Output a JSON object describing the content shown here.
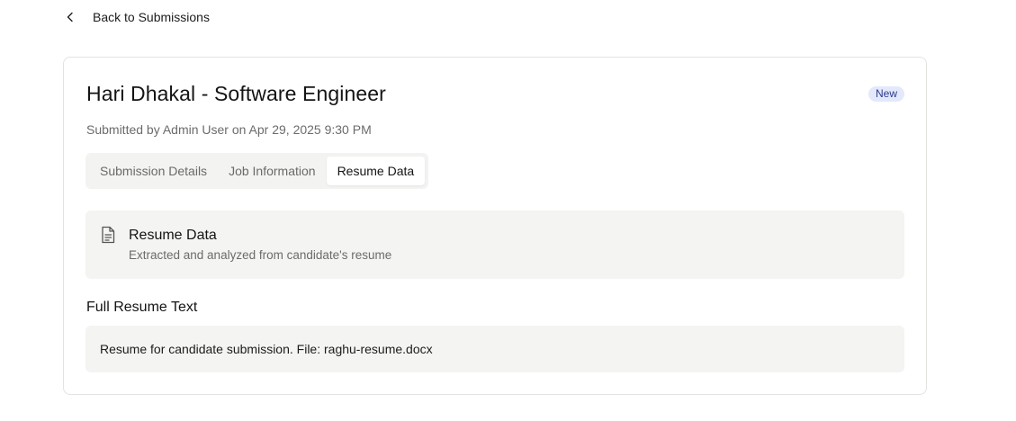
{
  "nav": {
    "back_label": "Back to Submissions",
    "back_icon": "chevron-left-icon"
  },
  "submission": {
    "title": "Hari Dhakal - Software Engineer",
    "status_badge": "New",
    "subtitle": "Submitted by Admin User on Apr 29, 2025 9:30 PM"
  },
  "tabs": [
    {
      "label": "Submission Details",
      "active": false
    },
    {
      "label": "Job Information",
      "active": false
    },
    {
      "label": "Resume Data",
      "active": true
    }
  ],
  "resume_panel": {
    "icon": "document-icon",
    "title": "Resume Data",
    "description": "Extracted and analyzed from candidate's resume"
  },
  "full_text": {
    "heading": "Full Resume Text",
    "content": "Resume for candidate submission. File: raghu-resume.docx"
  },
  "colors": {
    "badge_bg": "#e3e9fb",
    "badge_text": "#2a3a8c",
    "panel_bg": "#f4f4f2"
  }
}
